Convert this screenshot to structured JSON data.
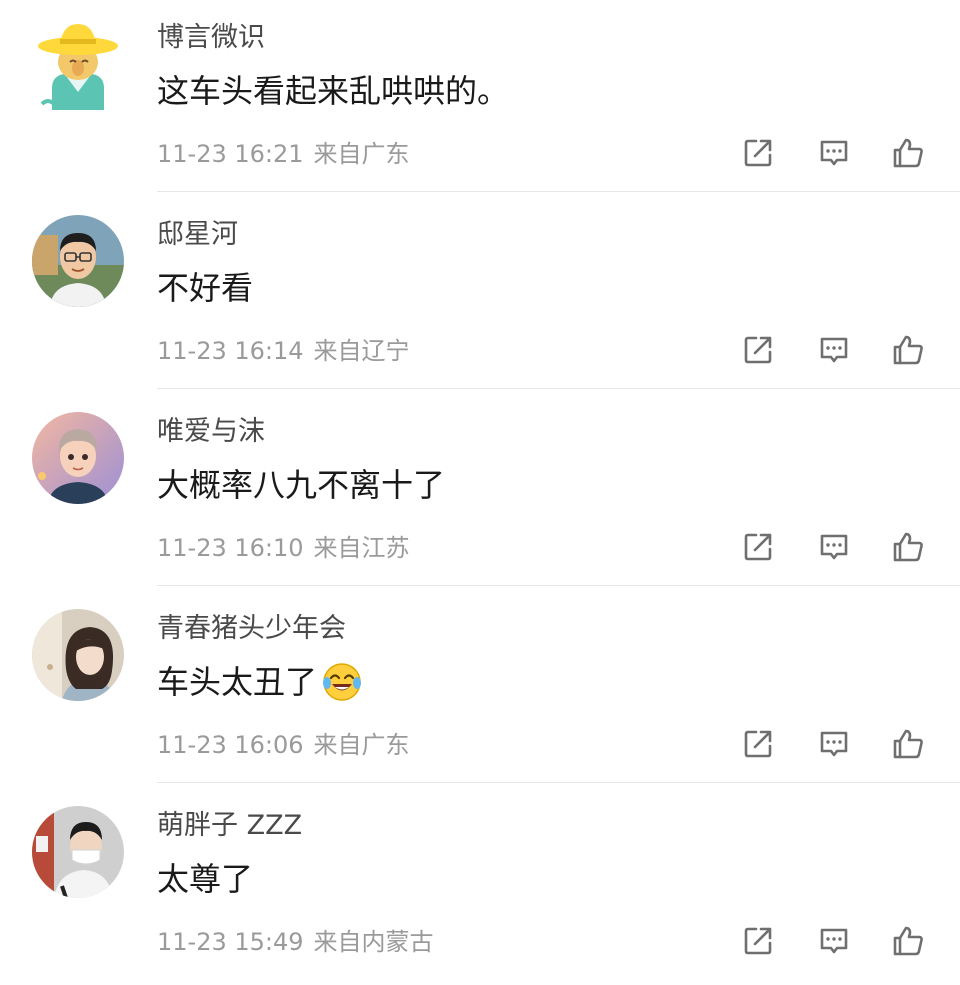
{
  "comments": [
    {
      "username": "博言微识",
      "content": "这车头看起来乱哄哄的。",
      "time": "11-23 16:21",
      "location": "来自广东",
      "avatar_icon": "straw-hat-cartoon-avatar"
    },
    {
      "username": "邸星河",
      "content": "不好看",
      "time": "11-23 16:14",
      "location": "来自辽宁",
      "avatar_icon": "man-with-glasses-photo-avatar"
    },
    {
      "username": "唯爱与沫",
      "content": "大概率八九不离十了",
      "time": "11-23 16:10",
      "location": "来自江苏",
      "avatar_icon": "cartoon-boy-avatar"
    },
    {
      "username": "青春猪头少年会",
      "content": "车头太丑了",
      "emoji": "laughing-crying-emoji",
      "time": "11-23 16:06",
      "location": "来自广东",
      "avatar_icon": "girl-photo-avatar"
    },
    {
      "username": "萌胖子 ZZZ",
      "content": "太尊了",
      "time": "11-23 15:49",
      "location": "来自内蒙古",
      "avatar_icon": "masked-boy-photo-avatar"
    }
  ],
  "action_icons": [
    "share-icon",
    "reply-icon",
    "like-icon"
  ],
  "colors": {
    "username": "#4a4a4a",
    "content": "#1a1a1a",
    "meta": "#9a9a9a",
    "divider": "#e6e6e6",
    "icon": "#6f6f6f"
  }
}
